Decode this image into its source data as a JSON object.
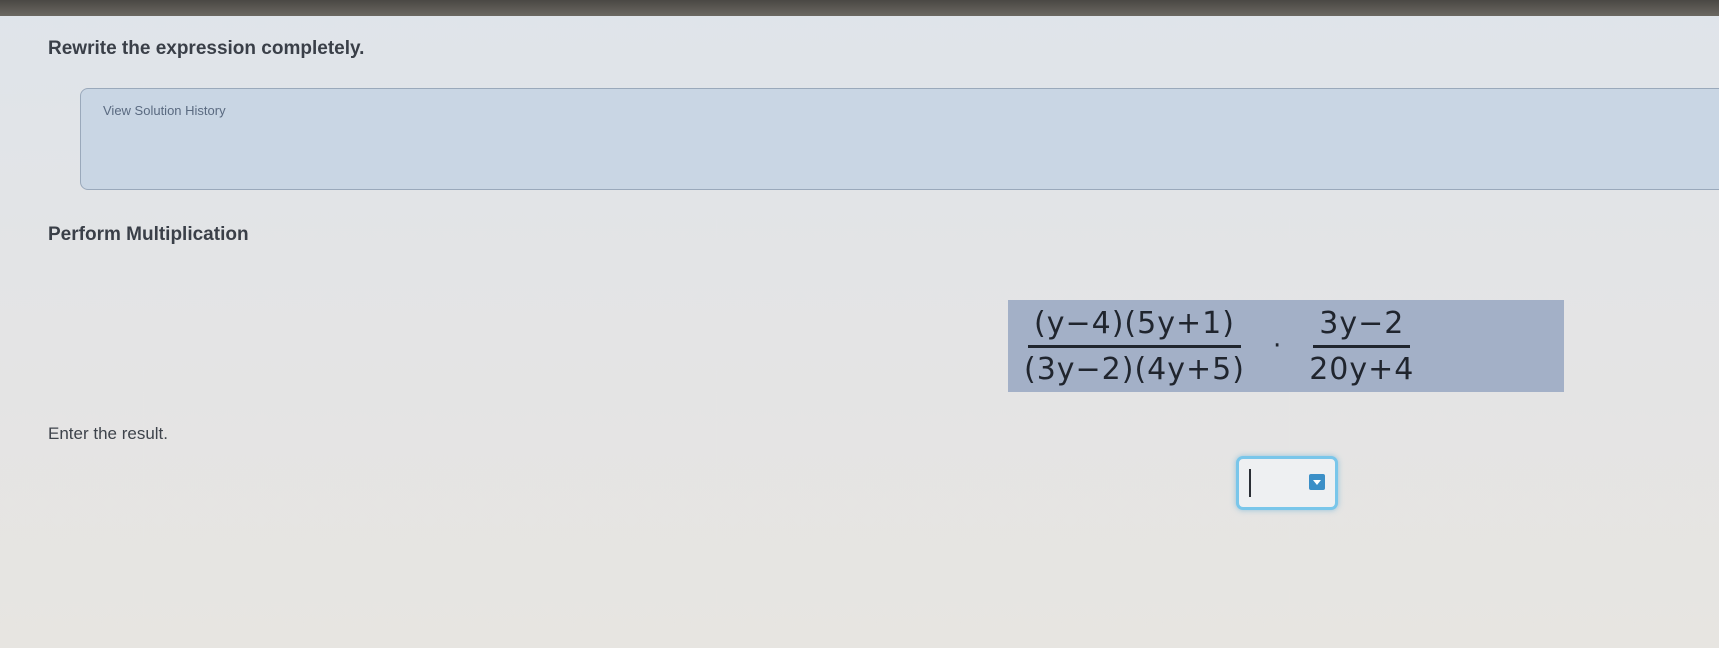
{
  "instruction": "Rewrite the expression completely.",
  "history": {
    "link_label": "View Solution History"
  },
  "step": {
    "title": "Perform Multiplication"
  },
  "expression": {
    "left_numerator": "(y−4)(5y+1)",
    "left_denominator": "(3y−2)(4y+5)",
    "operator": "·",
    "right_numerator": "3y−2",
    "right_denominator": "20y+4"
  },
  "answer": {
    "label": "Enter the result.",
    "value": ""
  },
  "colors": {
    "expression_highlight": "#a3b0c7",
    "history_panel": "#c9d6e4",
    "answer_focus_border": "#79c6ea",
    "dropdown_accent": "#3b8fc7"
  },
  "icons": {
    "dropdown": "chevron-down-icon"
  }
}
